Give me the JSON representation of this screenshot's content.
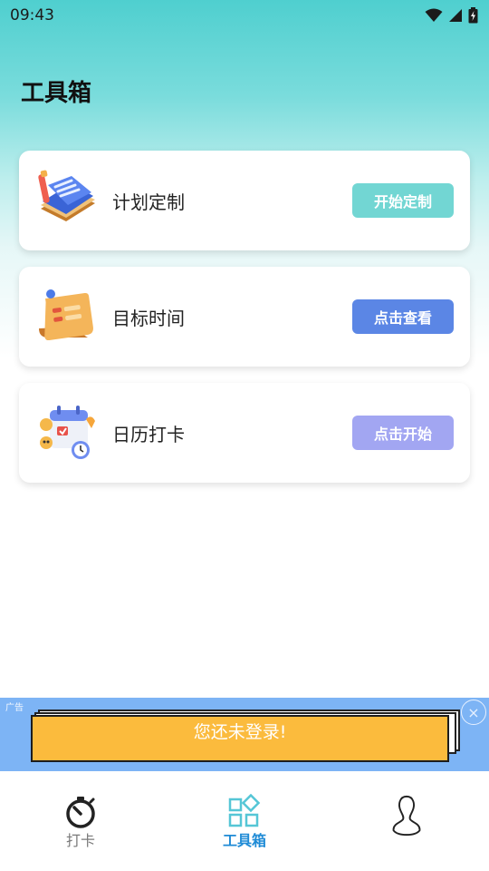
{
  "status_bar": {
    "time": "09:43"
  },
  "page": {
    "title": "工具箱"
  },
  "tools": [
    {
      "label": "计划定制",
      "button": "开始定制",
      "button_color": "#72d6d3",
      "icon": "planner-book-icon"
    },
    {
      "label": "目标时间",
      "button": "点击查看",
      "button_color": "#5b86e5",
      "icon": "scroll-note-icon"
    },
    {
      "label": "日历打卡",
      "button": "点击开始",
      "button_color": "#a2a6f2",
      "icon": "calendar-checkin-icon"
    }
  ],
  "ad": {
    "tag": "广告",
    "text": "您还未登录!",
    "close": "×"
  },
  "nav": {
    "items": [
      {
        "label": "打卡",
        "icon": "stopwatch-icon",
        "active": false
      },
      {
        "label": "工具箱",
        "icon": "toolbox-grid-icon",
        "active": true
      },
      {
        "label": "",
        "icon": "profile-icon",
        "active": false
      }
    ],
    "active_color": "#1f8bd6",
    "inactive_color": "#7a7a7a"
  }
}
